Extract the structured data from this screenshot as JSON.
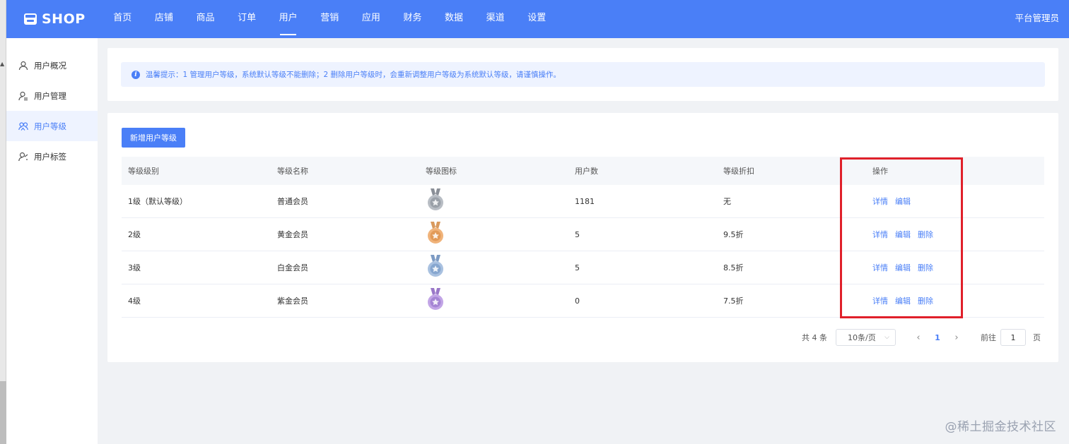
{
  "app": {
    "logo_text": "SHOP",
    "admin_label": "平台管理员"
  },
  "nav": [
    {
      "label": "首页",
      "active": false
    },
    {
      "label": "店铺",
      "active": false
    },
    {
      "label": "商品",
      "active": false
    },
    {
      "label": "订单",
      "active": false
    },
    {
      "label": "用户",
      "active": true
    },
    {
      "label": "营销",
      "active": false
    },
    {
      "label": "应用",
      "active": false
    },
    {
      "label": "财务",
      "active": false
    },
    {
      "label": "数据",
      "active": false
    },
    {
      "label": "渠道",
      "active": false
    },
    {
      "label": "设置",
      "active": false
    }
  ],
  "sidebar": [
    {
      "label": "用户概况",
      "icon": "user-icon",
      "active": false
    },
    {
      "label": "用户管理",
      "icon": "user-manage-icon",
      "active": false
    },
    {
      "label": "用户等级",
      "icon": "users-icon",
      "active": true
    },
    {
      "label": "用户标签",
      "icon": "user-tag-icon",
      "active": false
    }
  ],
  "tip": {
    "text": "温馨提示：1 管理用户等级，系统默认等级不能删除；2 删除用户等级时，会重新调整用户等级为系统默认等级，请谨慎操作。"
  },
  "add_button": "新增用户等级",
  "table": {
    "headers": [
      "等级级别",
      "等级名称",
      "等级图标",
      "用户数",
      "等级折扣",
      "操作"
    ],
    "rows": [
      {
        "level": "1级（默认等级）",
        "name": "普通会员",
        "medal": "silver",
        "users": "1181",
        "discount": "无",
        "actions": [
          "详情",
          "编辑"
        ]
      },
      {
        "level": "2级",
        "name": "黄金会员",
        "medal": "gold",
        "users": "5",
        "discount": "9.5折",
        "actions": [
          "详情",
          "编辑",
          "删除"
        ]
      },
      {
        "level": "3级",
        "name": "白金会员",
        "medal": "platinum",
        "users": "5",
        "discount": "8.5折",
        "actions": [
          "详情",
          "编辑",
          "删除"
        ]
      },
      {
        "level": "4级",
        "name": "紫金会员",
        "medal": "purple",
        "users": "0",
        "discount": "7.5折",
        "actions": [
          "详情",
          "编辑",
          "删除"
        ]
      }
    ]
  },
  "pagination": {
    "total": "共 4 条",
    "page_size": "10条/页",
    "current_page": "1",
    "goto_label": "前往",
    "goto_value": "1",
    "page_unit": "页"
  },
  "watermark": "@稀土掘金技术社区",
  "colors": {
    "primary": "#4a7ff7",
    "highlight_box": "#e0202a"
  }
}
